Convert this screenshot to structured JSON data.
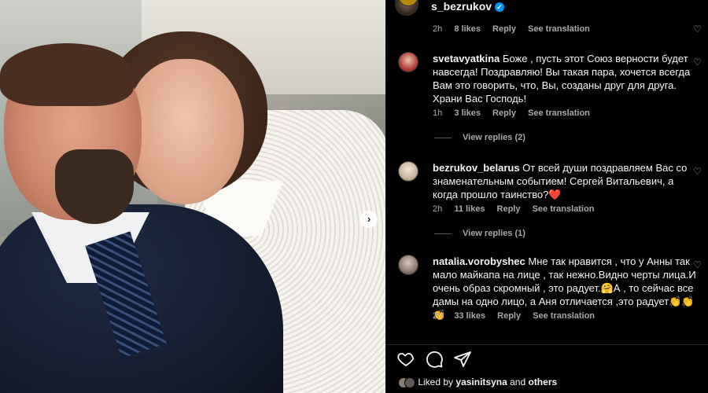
{
  "post": {
    "username": "s_bezrukov",
    "verified": true,
    "carousel_next_icon": "chevron-right-icon"
  },
  "top_comment_meta": {
    "time": "2h",
    "likes": "8 likes",
    "reply": "Reply",
    "translate": "See translation"
  },
  "comments": [
    {
      "username": "svetavyatkina",
      "text": "Боже , пусть этот Союз верности будет навсегда! Поздравляю! Вы такая пара, хочется всегда Вам это говорить, что, Вы, созданы друг для друга. Храни Вас Господь!",
      "time": "1h",
      "likes": "3 likes",
      "reply": "Reply",
      "translate": "See translation",
      "view_replies": "View replies (2)"
    },
    {
      "username": "bezrukov_belarus",
      "text": "От всей души поздравляем Вас со знаменательным событием! Сергей Витальевич, а когда прошло таинство?❤️",
      "time": "2h",
      "likes": "11 likes",
      "reply": "Reply",
      "translate": "See translation",
      "view_replies": "View replies (1)"
    },
    {
      "username": "natalia.vorobyshec",
      "text": "Мне так нравится , что у Анны так мало майкапа на лице , так нежно.Видно черты лица.И очень образ скромный , это радует.🤗А , то сейчас все дамы на одно лицо, а Аня отличается ,это радует👏👏👏",
      "time": "2h",
      "likes": "33 likes",
      "reply": "Reply",
      "translate": "See translation"
    }
  ],
  "liked_by": {
    "prefix": "Liked by",
    "user": "yasinitsyna",
    "and": "and",
    "others": "others"
  },
  "colors": {
    "background": "#000000",
    "text": "#f5f5f5",
    "muted": "#a8a8a8",
    "verified": "#0095f6"
  }
}
